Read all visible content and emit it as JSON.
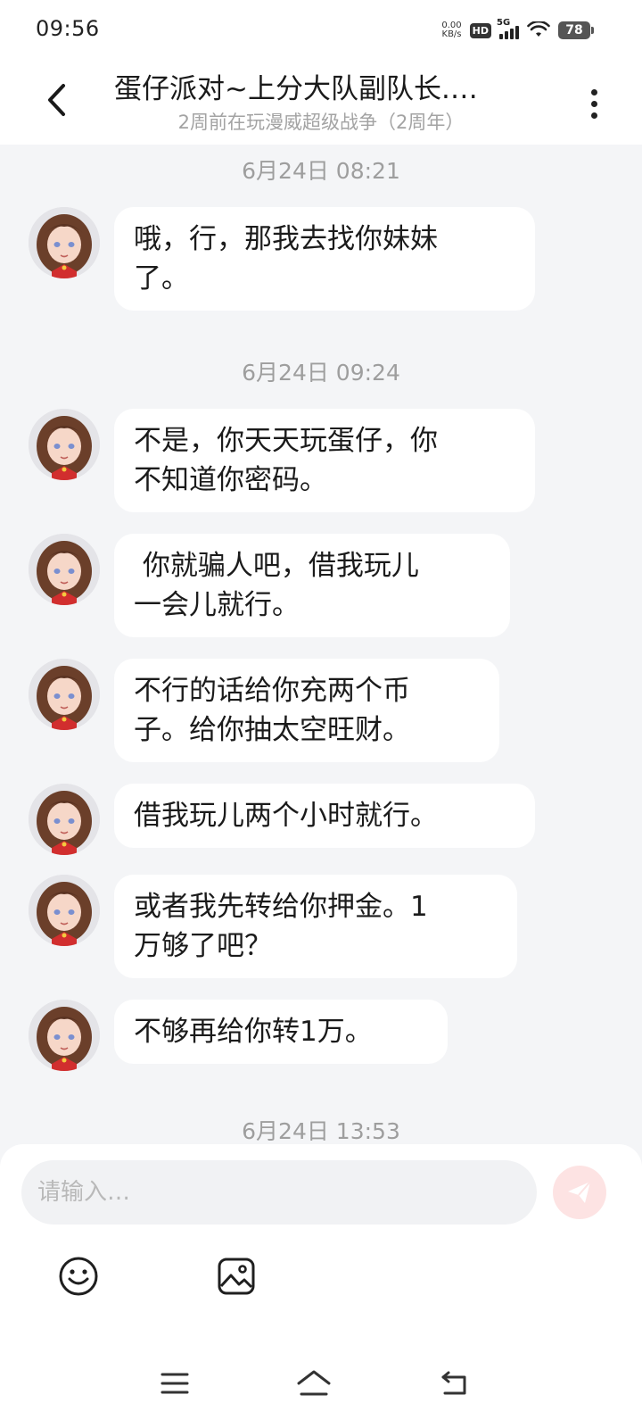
{
  "status_bar": {
    "time": "09:56",
    "net_speed_value": "0.00",
    "net_speed_unit": "KB/s",
    "hd_badge": "HD",
    "network_type": "5G",
    "battery": "78"
  },
  "header": {
    "title": "蛋仔派对~上分大队副队长.…",
    "subtitle": "2周前在玩漫威超级战争（2周年）"
  },
  "messages": [
    {
      "timestamp": "6月24日 08:21"
    },
    {
      "text": "哦，行，那我去找你妹妹\n了。"
    },
    {
      "timestamp": "6月24日 09:24"
    },
    {
      "text": "不是，你天天玩蛋仔，你\n不知道你密码。"
    },
    {
      "text": " 你就骗人吧，借我玩儿\n一会儿就行。"
    },
    {
      "text": "不行的话给你充两个币\n子。给你抽太空旺财。"
    },
    {
      "text": "借我玩儿两个小时就行。"
    },
    {
      "text": "或者我先转给你押金。1\n万够了吧？"
    },
    {
      "text": "不够再给你转1万。"
    },
    {
      "timestamp": "6月24日 13:53"
    }
  ],
  "input": {
    "placeholder": "请输入…"
  },
  "icons": {
    "back": "back-arrow-icon",
    "more": "more-vertical-icon",
    "send": "send-plane-icon",
    "emoji": "emoji-icon",
    "image": "image-icon",
    "nav_menu": "menu-lines-icon",
    "nav_home": "home-icon",
    "nav_back": "return-icon"
  },
  "colors": {
    "background": "#f4f5f7",
    "bubble": "#ffffff",
    "send_button": "#fde3e3",
    "send_icon": "#ffffff"
  }
}
